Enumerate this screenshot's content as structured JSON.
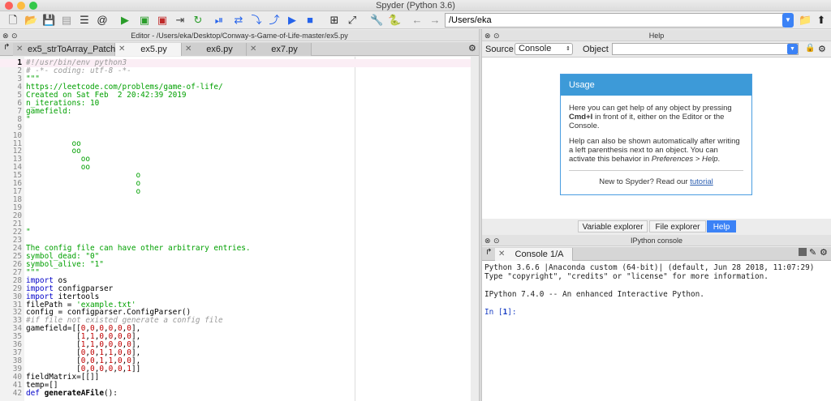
{
  "window": {
    "title": "Spyder (Python 3.6)"
  },
  "toolbar": {
    "path": "/Users/eka",
    "icons": [
      "new-file-icon",
      "open-file-icon",
      "save-icon",
      "save-all-icon",
      "list-icon",
      "at-icon",
      "run-icon",
      "run-cell-icon",
      "run-cell-advance-icon",
      "run-selection-icon",
      "rerun-icon",
      "debug-icon",
      "step-icon",
      "step-into-icon",
      "step-return-icon",
      "continue-icon",
      "stop-icon",
      "maximize-icon",
      "fullscreen-icon",
      "wrench-icon",
      "python-icon",
      "back-icon",
      "forward-icon",
      "folder-icon",
      "up-icon"
    ]
  },
  "editor": {
    "pane_title": "Editor - /Users/eka/Desktop/Conway-s-Game-of-Life-master/ex5.py",
    "tabs": [
      {
        "label": "ex5_strToArray_Patch.py"
      },
      {
        "label": "ex5.py"
      },
      {
        "label": "ex6.py"
      },
      {
        "label": "ex7.py"
      }
    ],
    "lines": [
      {
        "n": "1",
        "t": "#!/usr/bin/env python3",
        "c": "com"
      },
      {
        "n": "2",
        "t": "# -*- coding: utf-8 -*-",
        "c": "com"
      },
      {
        "n": "3",
        "t": "\"\"\"",
        "c": "str"
      },
      {
        "n": "4",
        "t": "https://leetcode.com/problems/game-of-life/",
        "c": "str"
      },
      {
        "n": "5",
        "t": "Created on Sat Feb  2 20:42:39 2019",
        "c": "str"
      },
      {
        "n": "6",
        "t": "n_iterations: 10",
        "c": "str"
      },
      {
        "n": "7",
        "t": "gamefield:",
        "c": "str"
      },
      {
        "n": "8",
        "t": "\"",
        "c": "str"
      },
      {
        "n": "9",
        "t": "",
        "c": "str"
      },
      {
        "n": "10",
        "t": "",
        "c": "str"
      },
      {
        "n": "11",
        "t": "          oo",
        "c": "str"
      },
      {
        "n": "12",
        "t": "          oo",
        "c": "str"
      },
      {
        "n": "13",
        "t": "            oo",
        "c": "str"
      },
      {
        "n": "14",
        "t": "            oo",
        "c": "str"
      },
      {
        "n": "15",
        "t": "                        o",
        "c": "str"
      },
      {
        "n": "16",
        "t": "                        o",
        "c": "str"
      },
      {
        "n": "17",
        "t": "                        o",
        "c": "str"
      },
      {
        "n": "18",
        "t": "",
        "c": "str"
      },
      {
        "n": "19",
        "t": "",
        "c": "str"
      },
      {
        "n": "20",
        "t": "",
        "c": "str"
      },
      {
        "n": "21",
        "t": "",
        "c": "str"
      },
      {
        "n": "22",
        "t": "\"",
        "c": "str"
      },
      {
        "n": "23",
        "t": "",
        "c": "str"
      },
      {
        "n": "24",
        "t": "The config file can have other arbitrary entries.",
        "c": "str"
      },
      {
        "n": "25",
        "t": "symbol_dead: \"0\"",
        "c": "str"
      },
      {
        "n": "26",
        "t": "symbol_alive: \"1\"",
        "c": "str"
      },
      {
        "n": "27",
        "t": "\"\"\"",
        "c": "str"
      },
      {
        "n": "28",
        "t": "import os",
        "c": "imp"
      },
      {
        "n": "29",
        "t": "import configparser",
        "c": "imp"
      },
      {
        "n": "30",
        "t": "import itertools",
        "c": "imp"
      },
      {
        "n": "31",
        "t": "filePath = 'example.txt'",
        "c": "fp"
      },
      {
        "n": "32",
        "t": "config = configparser.ConfigParser()",
        "c": "plain"
      },
      {
        "n": "33",
        "t": "#if file not existed generate a config file",
        "c": "com"
      },
      {
        "n": "34",
        "t": "gamefield=[[0,0,0,0,0,0],",
        "c": "arr"
      },
      {
        "n": "35",
        "t": "           [1,1,0,0,0,0],",
        "c": "arr"
      },
      {
        "n": "36",
        "t": "           [1,1,0,0,0,0],",
        "c": "arr"
      },
      {
        "n": "37",
        "t": "           [0,0,1,1,0,0],",
        "c": "arr"
      },
      {
        "n": "38",
        "t": "           [0,0,1,1,0,0],",
        "c": "arr"
      },
      {
        "n": "39",
        "t": "           [0,0,0,0,0,1]]",
        "c": "arr"
      },
      {
        "n": "40",
        "t": "fieldMatrix=[[]]",
        "c": "plain"
      },
      {
        "n": "41",
        "t": "temp=[]",
        "c": "plain"
      },
      {
        "n": "42",
        "t": "def generateAFile():",
        "c": "def"
      }
    ]
  },
  "help": {
    "pane_title": "Help",
    "source_label": "Source",
    "source_value": "Console",
    "object_label": "Object",
    "card_title": "Usage",
    "card_p1_a": "Here you can get help of any object by pressing ",
    "card_p1_b": "Cmd+I",
    "card_p1_c": " in front of it, either on the Editor or the Console.",
    "card_p2_a": "Help can also be shown automatically after writing a left parenthesis next to an object. You can activate this behavior in ",
    "card_p2_b": "Preferences > Help",
    "card_p2_c": ".",
    "card_footer_a": "New to Spyder? Read our ",
    "card_footer_link": "tutorial",
    "bottom_tabs": [
      "Variable explorer",
      "File explorer",
      "Help"
    ]
  },
  "console": {
    "pane_title": "IPython console",
    "tab_label": "Console 1/A",
    "lines": [
      "Python 3.6.6 |Anaconda custom (64-bit)| (default, Jun 28 2018, 11:07:29)",
      "Type \"copyright\", \"credits\" or \"license\" for more information.",
      "",
      "IPython 7.4.0 -- An enhanced Interactive Python.",
      "",
      "In [1]:"
    ]
  }
}
